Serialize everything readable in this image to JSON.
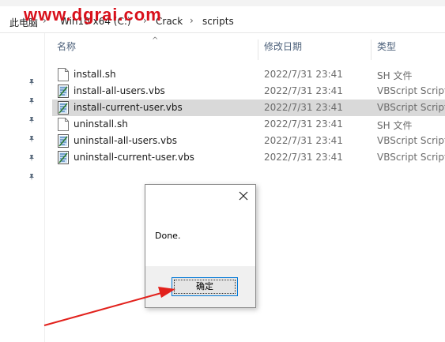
{
  "watermark": "www.dgrai.com",
  "breadcrumb": {
    "items": [
      "此电脑",
      "Win10 x64 (C:)",
      "Crack",
      "scripts"
    ]
  },
  "columns": {
    "name": "名称",
    "date": "修改日期",
    "type": "类型"
  },
  "files": [
    {
      "name": "install.sh",
      "date": "2022/7/31 23:41",
      "type": "SH 文件",
      "icon": "sh-file-icon"
    },
    {
      "name": "install-all-users.vbs",
      "date": "2022/7/31 23:41",
      "type": "VBScript Script",
      "icon": "vbs-file-icon"
    },
    {
      "name": "install-current-user.vbs",
      "date": "2022/7/31 23:41",
      "type": "VBScript Script",
      "icon": "vbs-file-icon",
      "selected": true
    },
    {
      "name": "uninstall.sh",
      "date": "2022/7/31 23:41",
      "type": "SH 文件",
      "icon": "sh-file-icon"
    },
    {
      "name": "uninstall-all-users.vbs",
      "date": "2022/7/31 23:41",
      "type": "VBScript Script",
      "icon": "vbs-file-icon"
    },
    {
      "name": "uninstall-current-user.vbs",
      "date": "2022/7/31 23:41",
      "type": "VBScript Script",
      "icon": "vbs-file-icon"
    }
  ],
  "dialog": {
    "message": "Done.",
    "ok_label": "确定",
    "close_icon": "close-icon"
  },
  "colors": {
    "watermark": "#d8101b",
    "arrow": "#e2211c",
    "selection": "#d9d9d9",
    "button_border": "#0078d7"
  }
}
